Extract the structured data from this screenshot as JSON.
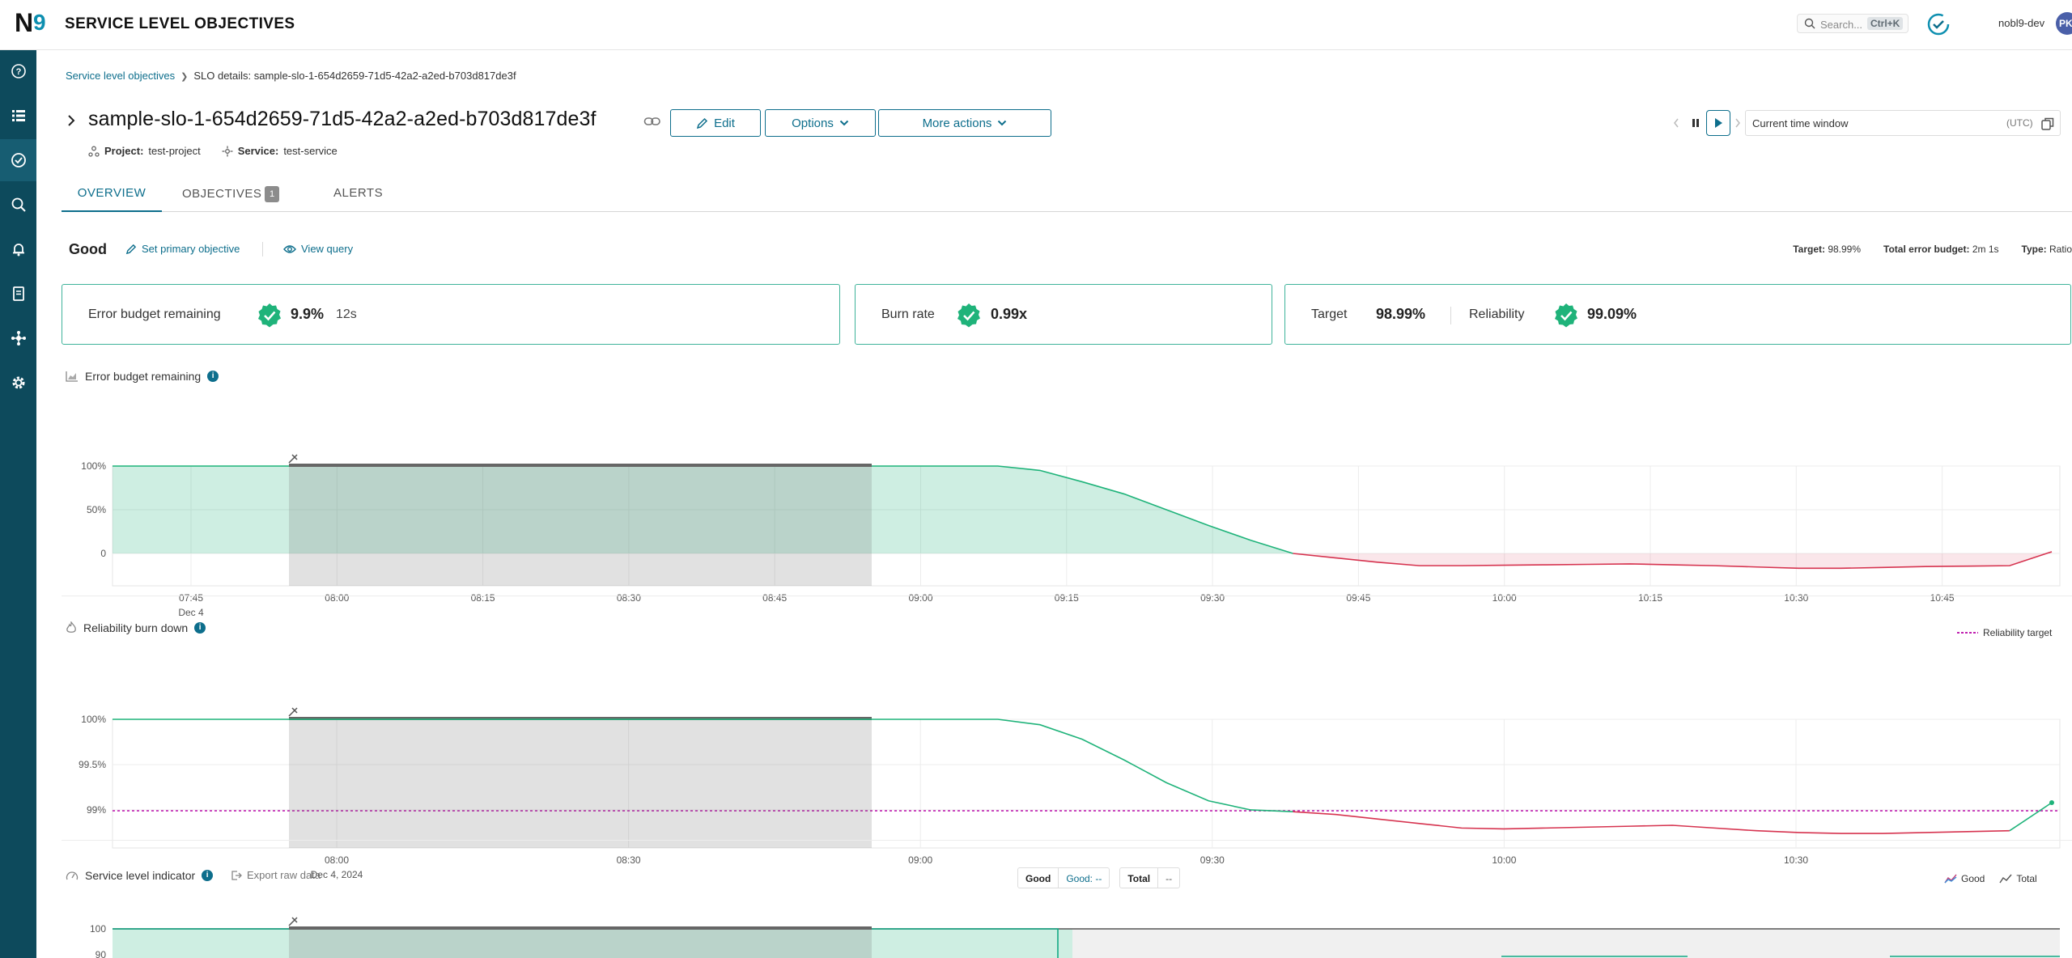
{
  "app": {
    "title": "SERVICE LEVEL OBJECTIVES",
    "logo_text": "N9"
  },
  "search": {
    "placeholder": "Search...",
    "shortcut": "Ctrl+K"
  },
  "user": {
    "org": "nobl9-dev",
    "initials": "PK"
  },
  "sidenav": {
    "items": [
      "help-icon",
      "list-icon",
      "slo-icon",
      "search-icon",
      "bell-icon",
      "report-icon",
      "integrations-icon",
      "settings-icon"
    ],
    "active_index": 2
  },
  "breadcrumb": {
    "root": "Service level objectives",
    "current": "SLO details: sample-slo-1-654d2659-71d5-42a2-a2ed-b703d817de3f"
  },
  "slo": {
    "name": "sample-slo-1-654d2659-71d5-42a2-a2ed-b703d817de3f",
    "project_label": "Project:",
    "project": "test-project",
    "service_label": "Service:",
    "service": "test-service"
  },
  "actions": {
    "edit": "Edit",
    "options": "Options",
    "more": "More actions"
  },
  "time_window": {
    "label": "Current time window",
    "tz": "(UTC)"
  },
  "tabs": {
    "overview": "OVERVIEW",
    "objectives": "OBJECTIVES",
    "objectives_count": "1",
    "alerts": "ALERTS"
  },
  "objective": {
    "name": "Good",
    "set_primary": "Set primary objective",
    "view_query": "View query",
    "target_label": "Target:",
    "target": "98.99%",
    "budget_label": "Total error budget:",
    "budget": "2m 1s",
    "type_label": "Type:",
    "type": "Ratio"
  },
  "cards": {
    "ebr_label": "Error budget remaining",
    "ebr_value": "9.9%",
    "ebr_time": "12s",
    "burn_label": "Burn rate",
    "burn_value": "0.99x",
    "target_label": "Target",
    "target_value": "98.99%",
    "reliability_label": "Reliability",
    "reliability_value": "99.09%"
  },
  "colors": {
    "accent": "#0d6e8c",
    "good": "#1fb37a",
    "bad": "#d6334f",
    "target_line": "#c020b0",
    "nav": "#0d4a5c"
  },
  "chart_data": [
    {
      "type": "area",
      "title": "Error budget remaining",
      "y_ticks": [
        "100%",
        "50%",
        "0"
      ],
      "ylim": [
        -18,
        100
      ],
      "x_ticks": [
        "07:45",
        "08:00",
        "08:15",
        "08:30",
        "08:45",
        "09:00",
        "09:15",
        "09:30",
        "09:45",
        "10:00",
        "10:15",
        "10:30",
        "10:45"
      ],
      "x_date": "Dec 4",
      "series": [
        {
          "values": [
            100,
            100,
            100,
            100,
            100,
            100,
            100,
            100,
            100,
            100,
            100,
            100,
            100,
            100,
            100,
            100,
            100,
            100,
            100,
            100,
            100,
            100,
            95,
            82,
            68,
            50,
            32,
            15,
            0,
            -5,
            -10,
            -14,
            -14,
            -13.5,
            -13,
            -12.5,
            -12,
            -13,
            -14,
            -15.5,
            -17,
            -17,
            -16,
            -15,
            -14.5,
            -14,
            2
          ]
        }
      ]
    },
    {
      "type": "line",
      "title": "Reliability burn down",
      "y_ticks": [
        "100%",
        "99.5%",
        "99%"
      ],
      "ylim": [
        98.58,
        100
      ],
      "x_ticks": [
        "08:00",
        "08:30",
        "09:00",
        "09:30",
        "10:00",
        "10:30"
      ],
      "x_date": "Dec 4, 2024",
      "legend": "Reliability target",
      "target": 98.99,
      "series": [
        {
          "values": [
            100,
            100,
            100,
            100,
            100,
            100,
            100,
            100,
            100,
            100,
            100,
            100,
            100,
            100,
            100,
            100,
            100,
            100,
            100,
            100,
            100,
            100,
            99.94,
            99.78,
            99.55,
            99.3,
            99.1,
            99.0,
            98.98,
            98.95,
            98.9,
            98.85,
            98.8,
            98.79,
            98.8,
            98.81,
            98.82,
            98.83,
            98.8,
            98.77,
            98.75,
            98.74,
            98.74,
            98.75,
            98.76,
            98.77,
            99.08
          ]
        }
      ]
    },
    {
      "type": "area",
      "title": "Service level indicator",
      "y_ticks": [
        "100",
        "90"
      ],
      "ylim": [
        0,
        100
      ]
    }
  ],
  "sli": {
    "export": "Export raw data",
    "pill_good_k": "Good",
    "pill_good_v": "Good: --",
    "pill_total_k": "Total",
    "pill_total_v": "--",
    "legend_good": "Good",
    "legend_total": "Total"
  }
}
